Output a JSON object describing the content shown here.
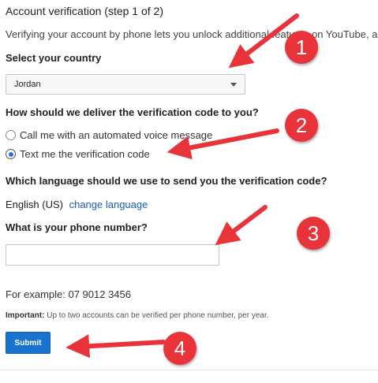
{
  "header": {
    "title": "Account verification (step 1 of 2)",
    "description": "Verifying your account by phone lets you unlock additional features on YouTube, and"
  },
  "country": {
    "label": "Select your country",
    "selected": "Jordan"
  },
  "delivery": {
    "label": "How should we deliver the verification code to you?",
    "options": [
      {
        "label": "Call me with an automated voice message",
        "checked": false
      },
      {
        "label": "Text me the verification code",
        "checked": true
      }
    ]
  },
  "language": {
    "label": "Which language should we use to send you the verification code?",
    "current": "English (US)",
    "change_link": "change language"
  },
  "phone": {
    "label": "What is your phone number?",
    "value": "",
    "example": "For example: 07 9012 3456"
  },
  "note": {
    "prefix": "Important:",
    "text": " Up to two accounts can be verified per phone number, per year."
  },
  "submit_label": "Submit",
  "callouts": [
    "1",
    "2",
    "3",
    "4"
  ],
  "colors": {
    "annotation_red": "#e8333b",
    "submit_blue": "#1b73d0",
    "link_blue": "#1a5fb4"
  }
}
